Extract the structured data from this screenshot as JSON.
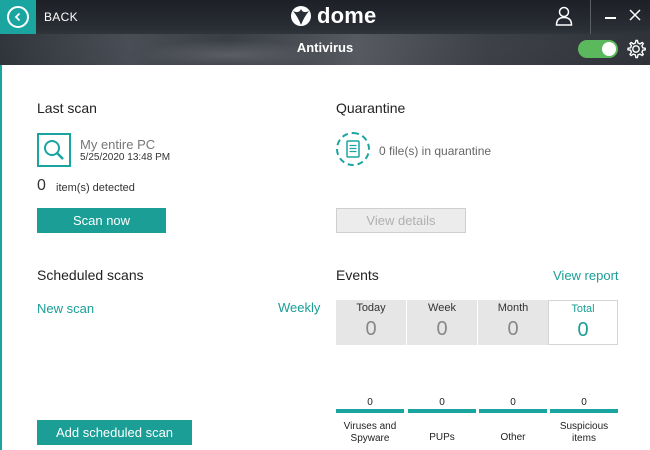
{
  "header": {
    "back_label": "BACK",
    "logo_text": "dome",
    "section_title": "Antivirus",
    "toggle_on": true
  },
  "last_scan": {
    "title": "Last scan",
    "target": "My entire PC",
    "date": "5/25/2020 13:48 PM",
    "detected_count": "0",
    "detected_label": "item(s) detected",
    "scan_now_label": "Scan now"
  },
  "quarantine": {
    "title": "Quarantine",
    "status": "0 file(s) in quarantine",
    "view_details_label": "View details"
  },
  "scheduled": {
    "title": "Scheduled scans",
    "new_scan": "New scan",
    "frequency": "Weekly",
    "add_label": "Add scheduled scan"
  },
  "events": {
    "title": "Events",
    "view_report": "View report",
    "periods": [
      {
        "label": "Today",
        "value": "0"
      },
      {
        "label": "Week",
        "value": "0"
      },
      {
        "label": "Month",
        "value": "0"
      },
      {
        "label": "Total",
        "value": "0"
      }
    ],
    "categories": [
      {
        "count": "0",
        "name_line1": "Viruses and",
        "name_line2": "Spyware"
      },
      {
        "count": "0",
        "name_line1": "PUPs",
        "name_line2": ""
      },
      {
        "count": "0",
        "name_line1": "Other",
        "name_line2": ""
      },
      {
        "count": "0",
        "name_line1": "Suspicious",
        "name_line2": "items"
      }
    ]
  },
  "colors": {
    "accent": "#1aa5a0",
    "button": "#1a9e96",
    "toggle": "#5cb85c"
  },
  "icons": [
    "chevron-left-icon",
    "dome-logo-icon",
    "user-icon",
    "minimize-icon",
    "close-icon",
    "gear-icon",
    "magnifier-icon",
    "document-icon"
  ]
}
